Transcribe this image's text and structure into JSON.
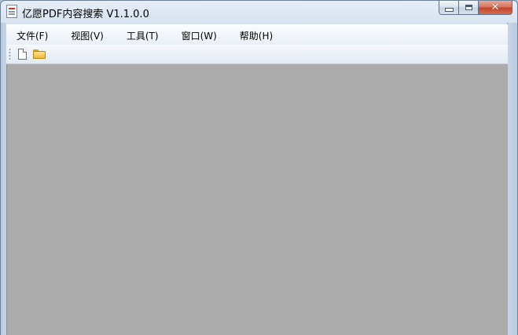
{
  "window": {
    "title": "亿愿PDF内容搜索 V1.1.0.0"
  },
  "caption": {
    "minimize_icon": "minimize-icon",
    "maximize_icon": "maximize-icon",
    "close_glyph": "✕"
  },
  "menu": {
    "items": [
      {
        "label": "文件(F)"
      },
      {
        "label": "视图(V)"
      },
      {
        "label": "工具(T)"
      },
      {
        "label": "窗口(W)"
      },
      {
        "label": "帮助(H)"
      }
    ]
  },
  "toolbar": {
    "buttons": [
      {
        "icon": "new-document-icon"
      },
      {
        "icon": "open-folder-icon"
      }
    ]
  },
  "colors": {
    "workspace": "#ababab",
    "frame": "#c8d6e8",
    "close_button": "#c2432a"
  }
}
